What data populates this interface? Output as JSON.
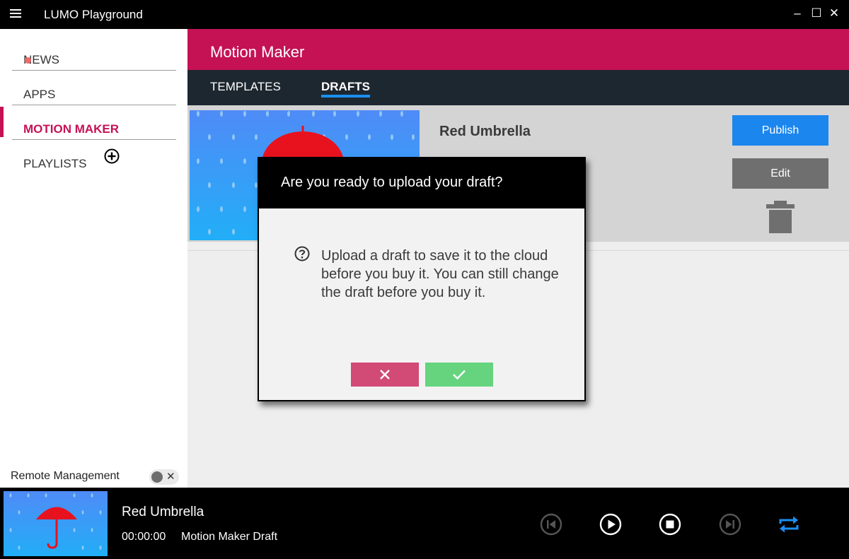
{
  "window": {
    "title": "LUMO Playground",
    "controls": {
      "minimize": "–",
      "maximize": "☐",
      "close": "✕"
    }
  },
  "sidebar": {
    "items": [
      {
        "label": "NEWS",
        "has_dot": true
      },
      {
        "label": "APPS"
      },
      {
        "label": "MOTION MAKER",
        "active": true
      },
      {
        "label": "PLAYLISTS",
        "icon": "add-circle-icon"
      }
    ],
    "remote_management": {
      "label": "Remote Management",
      "toggle_state": "off",
      "toggle_icon": "✕"
    }
  },
  "main": {
    "title": "Motion Maker",
    "tabs": [
      {
        "label": "TEMPLATES"
      },
      {
        "label": "DRAFTS",
        "active": true
      }
    ],
    "draft": {
      "title": "Red Umbrella",
      "publish_label": "Publish",
      "edit_label": "Edit"
    }
  },
  "dialog": {
    "title": "Are you ready to upload your draft?",
    "body": "Upload a draft to save it to the cloud before you buy it. You can still change the draft before you buy it.",
    "cancel_icon": "close-icon",
    "confirm_icon": "checkmark-icon"
  },
  "player": {
    "title": "Red Umbrella",
    "time": "00:00:00",
    "subtitle": "Motion Maker Draft",
    "controls": [
      "skip-previous-icon",
      "play-icon",
      "stop-icon",
      "skip-next-icon",
      "repeat-icon"
    ]
  },
  "colors": {
    "brand": "#c41255",
    "tab_bar": "#1d2730",
    "publish": "#1b86ee",
    "edit": "#6f6f6f",
    "cancel": "#d24a76",
    "confirm": "#66d47e",
    "repeat_active": "#1b8ff0"
  }
}
